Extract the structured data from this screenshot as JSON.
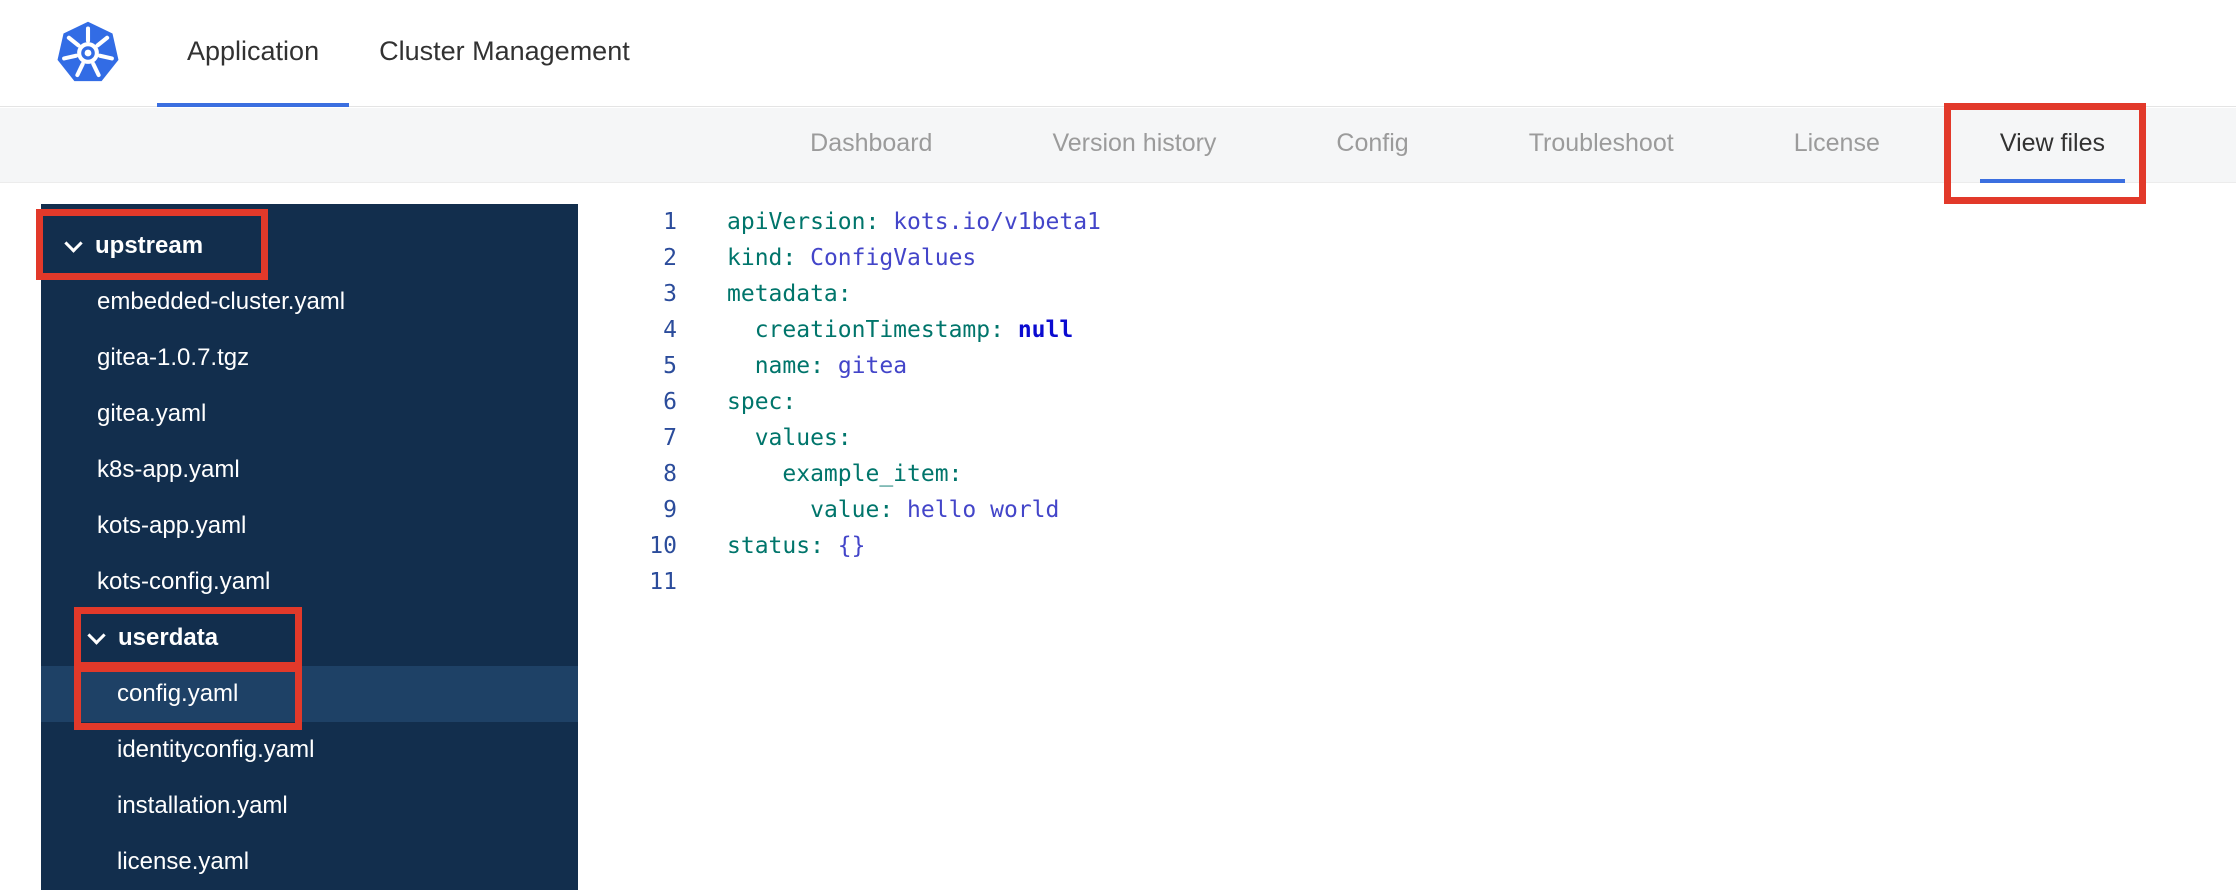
{
  "colors": {
    "accent_blue": "#3b6fe0",
    "annotation_red": "#e2392a",
    "sidebar_bg": "#122e4d",
    "sidebar_selected_bg": "#1e4166",
    "code_key": "#00756b",
    "code_value": "#4345c9",
    "code_null": "#0b0bd0",
    "gutter_number": "#2b4c9b",
    "logo_blue": "#326ce5"
  },
  "header": {
    "logo_icon": "kubernetes-logo",
    "tabs": [
      {
        "label": "Application",
        "active": true
      },
      {
        "label": "Cluster Management",
        "active": false
      }
    ]
  },
  "subnav": {
    "tabs": [
      {
        "label": "Dashboard",
        "active": false
      },
      {
        "label": "Version history",
        "active": false
      },
      {
        "label": "Config",
        "active": false
      },
      {
        "label": "Troubleshoot",
        "active": false
      },
      {
        "label": "License",
        "active": false
      },
      {
        "label": "View files",
        "active": true,
        "annotated": true
      }
    ]
  },
  "file_tree": [
    {
      "label": "upstream",
      "type": "folder",
      "level": 0,
      "expanded": true,
      "annotated": true
    },
    {
      "label": "embedded-cluster.yaml",
      "type": "file",
      "level": 1
    },
    {
      "label": "gitea-1.0.7.tgz",
      "type": "file",
      "level": 1
    },
    {
      "label": "gitea.yaml",
      "type": "file",
      "level": 1
    },
    {
      "label": "k8s-app.yaml",
      "type": "file",
      "level": 1
    },
    {
      "label": "kots-app.yaml",
      "type": "file",
      "level": 1
    },
    {
      "label": "kots-config.yaml",
      "type": "file",
      "level": 1
    },
    {
      "label": "userdata",
      "type": "folder",
      "level": 1,
      "expanded": true,
      "annotated": true
    },
    {
      "label": "config.yaml",
      "type": "file",
      "level": 2,
      "selected": true,
      "annotated": true
    },
    {
      "label": "identityconfig.yaml",
      "type": "file",
      "level": 2
    },
    {
      "label": "installation.yaml",
      "type": "file",
      "level": 2
    },
    {
      "label": "license.yaml",
      "type": "file",
      "level": 2
    }
  ],
  "editor": {
    "language": "yaml",
    "lines": [
      {
        "n": "1",
        "segments": [
          {
            "text": "apiVersion:",
            "type": "key"
          },
          {
            "text": " ",
            "type": "plain"
          },
          {
            "text": "kots.io/v1beta1",
            "type": "value"
          }
        ]
      },
      {
        "n": "2",
        "segments": [
          {
            "text": "kind:",
            "type": "key"
          },
          {
            "text": " ",
            "type": "plain"
          },
          {
            "text": "ConfigValues",
            "type": "value"
          }
        ]
      },
      {
        "n": "3",
        "segments": [
          {
            "text": "metadata:",
            "type": "key"
          }
        ]
      },
      {
        "n": "4",
        "segments": [
          {
            "text": "  ",
            "type": "plain"
          },
          {
            "text": "creationTimestamp:",
            "type": "key"
          },
          {
            "text": " ",
            "type": "plain"
          },
          {
            "text": "null",
            "type": "null"
          }
        ]
      },
      {
        "n": "5",
        "segments": [
          {
            "text": "  ",
            "type": "plain"
          },
          {
            "text": "name:",
            "type": "key"
          },
          {
            "text": " ",
            "type": "plain"
          },
          {
            "text": "gitea",
            "type": "value"
          }
        ]
      },
      {
        "n": "6",
        "segments": [
          {
            "text": "spec:",
            "type": "key"
          }
        ]
      },
      {
        "n": "7",
        "segments": [
          {
            "text": "  ",
            "type": "plain"
          },
          {
            "text": "values:",
            "type": "key"
          }
        ]
      },
      {
        "n": "8",
        "segments": [
          {
            "text": "    ",
            "type": "plain"
          },
          {
            "text": "example_item:",
            "type": "key"
          }
        ]
      },
      {
        "n": "9",
        "segments": [
          {
            "text": "      ",
            "type": "plain"
          },
          {
            "text": "value:",
            "type": "key"
          },
          {
            "text": " ",
            "type": "plain"
          },
          {
            "text": "hello world",
            "type": "value"
          }
        ]
      },
      {
        "n": "10",
        "segments": [
          {
            "text": "status:",
            "type": "key"
          },
          {
            "text": " ",
            "type": "plain"
          },
          {
            "text": "{}",
            "type": "value"
          }
        ]
      },
      {
        "n": "11",
        "segments": []
      }
    ]
  }
}
